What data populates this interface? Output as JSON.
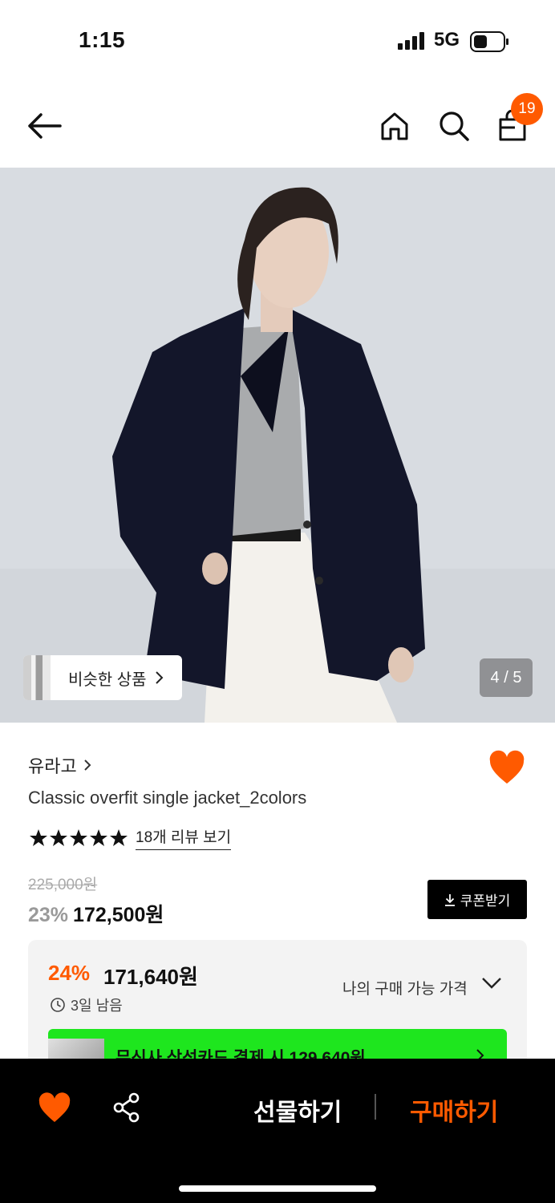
{
  "status_bar": {
    "time": "1:15",
    "network": "5G"
  },
  "header": {
    "cart_count": "19"
  },
  "gallery": {
    "similar_label": "비슷한 상품",
    "counter": "4 / 5"
  },
  "product": {
    "brand": "유라고",
    "title": "Classic overfit single jacket_2colors",
    "review_link": "18개 리뷰 보기",
    "rating_stars": 5,
    "original_price": "225,000원",
    "discount_rate": "23%",
    "sale_price": "172,500원",
    "coupon_label": "쿠폰받기"
  },
  "my_price": {
    "rate": "24%",
    "price": "171,640원",
    "timer": "3일 남음",
    "label": "나의 구매 가능 가격",
    "card_banner": "무신사 삼성카드 결제 시 129,640원"
  },
  "bottom_bar": {
    "gift_label": "선물하기",
    "buy_label": "구매하기"
  },
  "colors": {
    "accent": "#ff5a00",
    "banner_green": "#1ee61e"
  }
}
